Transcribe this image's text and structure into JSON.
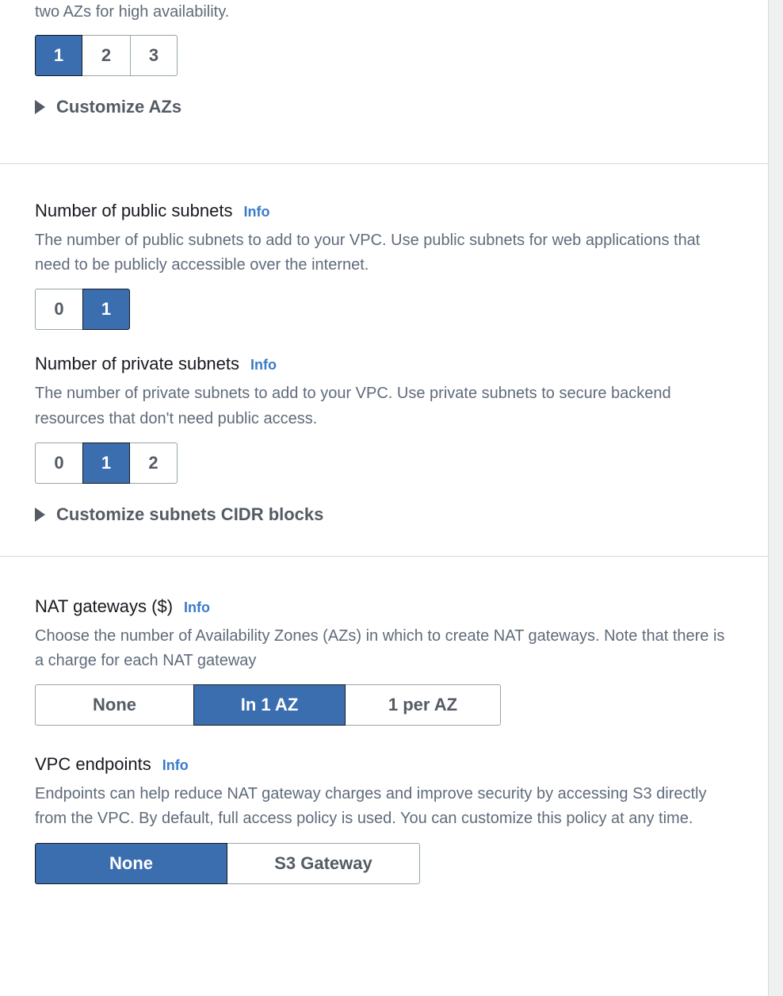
{
  "panel": {
    "lead_text": "two AZs for high availability.",
    "az": {
      "options": [
        "1",
        "2",
        "3"
      ],
      "selected": "1",
      "expander_label": "Customize AZs",
      "caret_icon": "triangle-right-icon"
    },
    "subnets": {
      "public": {
        "label": "Number of public subnets",
        "info_label": "Info",
        "description": "The number of public subnets to add to your VPC. Use public subnets for web applications that need to be publicly accessible over the internet.",
        "options": [
          "0",
          "1"
        ],
        "selected": "1"
      },
      "private": {
        "label": "Number of private subnets",
        "info_label": "Info",
        "description": "The number of private subnets to add to your VPC. Use private subnets to secure backend resources that don't need public access.",
        "options": [
          "0",
          "1",
          "2"
        ],
        "selected": "1"
      },
      "expander_label": "Customize subnets CIDR blocks",
      "caret_icon": "triangle-right-icon"
    },
    "nat_gateways": {
      "label": "NAT gateways ($)",
      "info_label": "Info",
      "description": "Choose the number of Availability Zones (AZs) in which to create NAT gateways. Note that there is a charge for each NAT gateway",
      "options": [
        "None",
        "In 1 AZ",
        "1 per AZ"
      ],
      "selected": "In 1 AZ"
    },
    "vpc_endpoints": {
      "label": "VPC endpoints",
      "info_label": "Info",
      "description": "Endpoints can help reduce NAT gateway charges and improve security by accessing S3 directly from the VPC. By default, full access policy is used. You can customize this policy at any time.",
      "options": [
        "None",
        "S3 Gateway"
      ],
      "selected": "None"
    }
  },
  "colors": {
    "accent_blue": "#3b6eaf",
    "link_blue": "#3a7bc8",
    "label_dark": "#16191f",
    "body_gray": "#5f6b7a",
    "border_gray": "#95a5a6",
    "divider_gray": "#d5dbdb",
    "page_bg": "#eff0f0"
  }
}
